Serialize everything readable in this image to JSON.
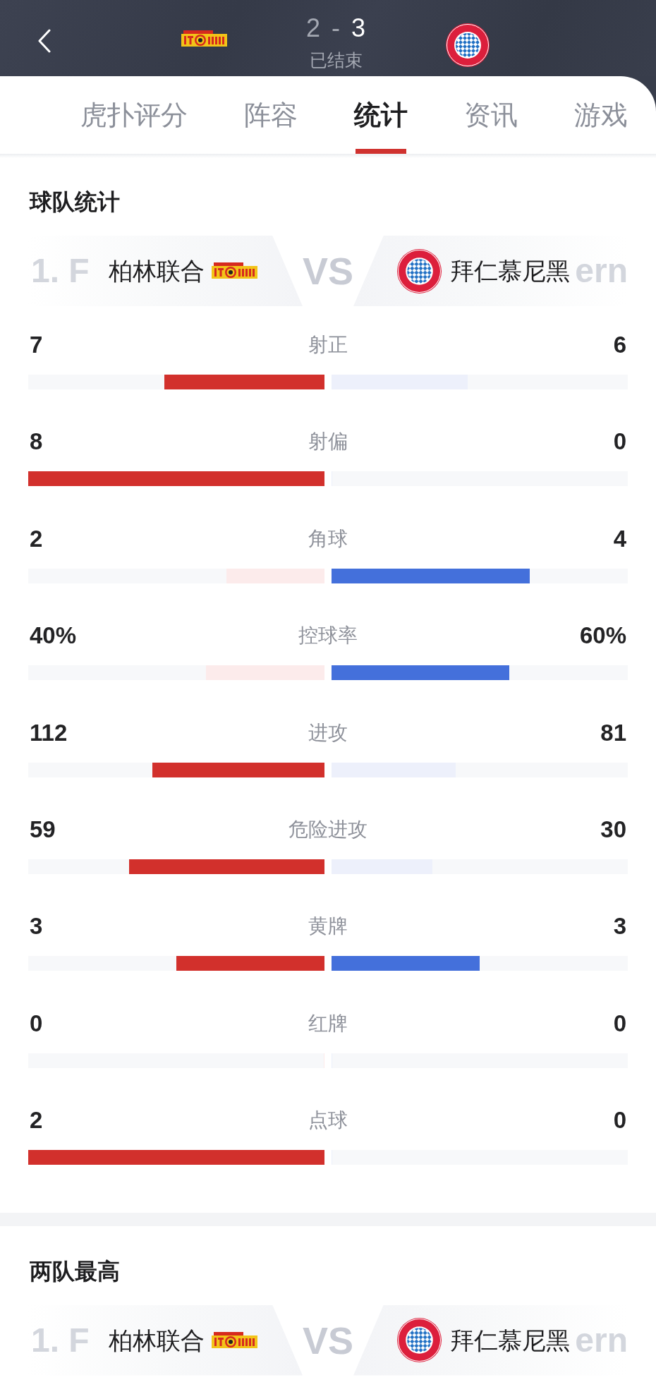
{
  "header": {
    "home": {
      "score": "2",
      "winner": false
    },
    "separator": "-",
    "away": {
      "score": "3",
      "winner": true
    },
    "status": "已结束"
  },
  "tabs": [
    {
      "label": "虎扑评分",
      "selected": false
    },
    {
      "label": "阵容",
      "selected": false
    },
    {
      "label": "统计",
      "selected": true
    },
    {
      "label": "资讯",
      "selected": false
    },
    {
      "label": "游戏",
      "selected": false
    }
  ],
  "team_stats": {
    "title": "球队统计",
    "matchup": {
      "home": {
        "backdrop": "1. F",
        "name": "柏林联合"
      },
      "vs": "VS",
      "away": {
        "name": "拜仁慕尼黑",
        "backdrop": "ern"
      }
    },
    "rows": [
      {
        "label": "射正",
        "home": {
          "value": "7",
          "level": 0.54
        },
        "away": {
          "value": "6",
          "level": 0.46
        }
      },
      {
        "label": "射偏",
        "home": {
          "value": "8",
          "level": 1
        },
        "away": {
          "value": "0",
          "level": 0
        }
      },
      {
        "label": "角球",
        "home": {
          "value": "2",
          "level": 0.33
        },
        "away": {
          "value": "4",
          "level": 0.67
        }
      },
      {
        "label": "控球率",
        "home": {
          "value": "40%",
          "level": 0.4
        },
        "away": {
          "value": "60%",
          "level": 0.6
        }
      },
      {
        "label": "进攻",
        "home": {
          "value": "112",
          "level": 0.58
        },
        "away": {
          "value": "81",
          "level": 0.42
        }
      },
      {
        "label": "危险进攻",
        "home": {
          "value": "59",
          "level": 0.66
        },
        "away": {
          "value": "30",
          "level": 0.34
        }
      },
      {
        "label": "黄牌",
        "home": {
          "value": "3",
          "level": 0.5
        },
        "away": {
          "value": "3",
          "level": 0.5
        }
      },
      {
        "label": "红牌",
        "home": {
          "value": "0",
          "level": 0
        },
        "away": {
          "value": "0",
          "level": 0
        }
      },
      {
        "label": "点球",
        "home": {
          "value": "2",
          "level": 1
        },
        "away": {
          "value": "0",
          "level": 0
        }
      }
    ]
  },
  "team_leaders": {
    "title": "两队最高",
    "matchup": {
      "home": {
        "backdrop": "1. F",
        "name": "柏林联合"
      },
      "vs": "VS",
      "away": {
        "name": "拜仁慕尼黑",
        "backdrop": "ern"
      }
    }
  }
}
